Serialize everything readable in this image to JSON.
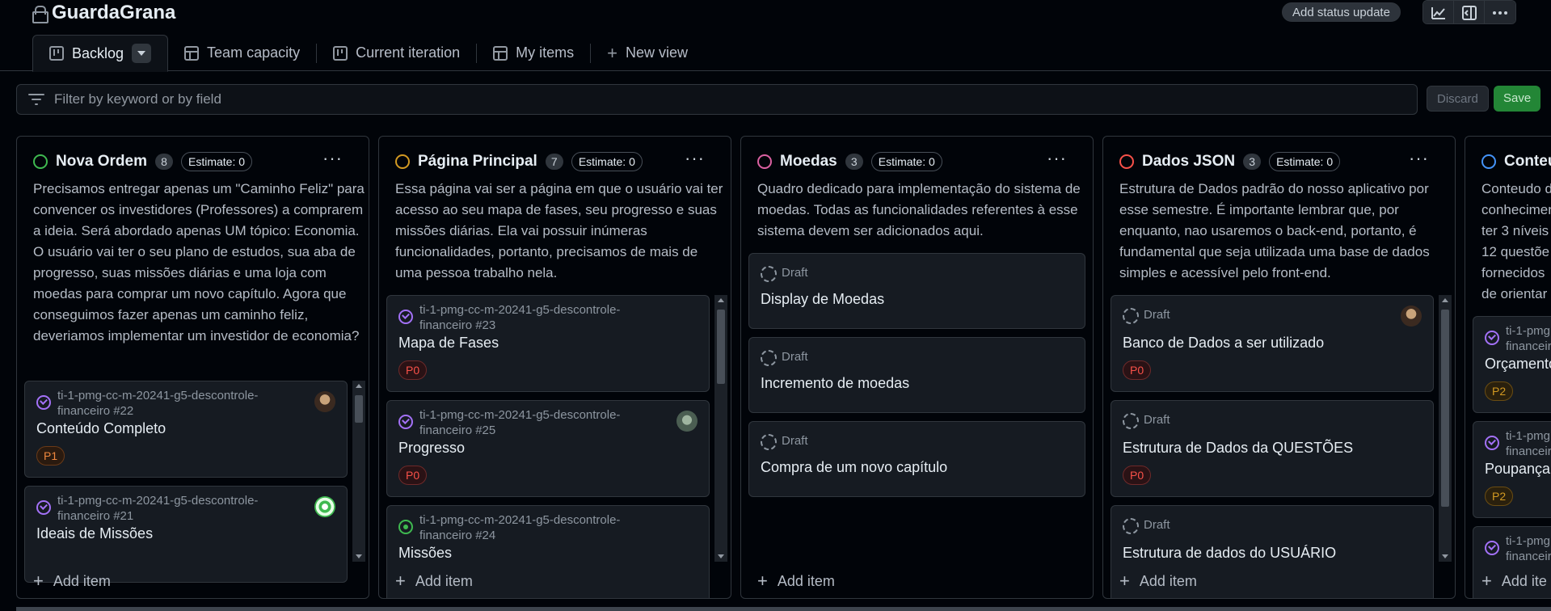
{
  "header": {
    "title": "GuardaGrana",
    "status_button": "Add status update",
    "action_icons": [
      "insights-icon",
      "sidebar-icon",
      "more-icon"
    ]
  },
  "tabs": [
    {
      "label": "Backlog",
      "icon": "board-icon",
      "active": true
    },
    {
      "label": "Team capacity",
      "icon": "table-icon"
    },
    {
      "label": "Current iteration",
      "icon": "board-icon"
    },
    {
      "label": "My items",
      "icon": "table-icon"
    },
    {
      "label": "New view",
      "icon": "plus-icon"
    }
  ],
  "filter": {
    "placeholder": "Filter by keyword or by field",
    "discard_label": "Discard",
    "save_label": "Save"
  },
  "columns": [
    {
      "title": "Nova Ordem",
      "count": "8",
      "estimate": "Estimate: 0",
      "color": "#3fb950",
      "description": "Precisamos entregar apenas um \"Caminho Feliz\" para convencer os investidores (Professores) a comprarem a ideia. Será abordado apenas UM tópico: Economia. O usuário vai ter o seu plano de estudos, sua aba de progresso, suas missões diárias e uma loja com moedas para comprar um novo capítulo. Agora que conseguimos fazer apenas um caminho feliz, deveriamos implementar um investidor de economia?",
      "cards": [
        {
          "ref": "ti-1-pmg-cc-m-20241-g5-descontrole-financeiro #22",
          "title": "Conteúdo Completo",
          "priority": "P1"
        },
        {
          "ref": "ti-1-pmg-cc-m-20241-g5-descontrole-financeiro #21",
          "title": "Ideais de Missões",
          "priority": ""
        }
      ],
      "add_item": "Add item"
    },
    {
      "title": "Página Principal",
      "count": "7",
      "estimate": "Estimate: 0",
      "color": "#d29922",
      "description": "Essa página vai ser a página em que o usuário vai ter acesso ao seu mapa de fases, seu progresso e suas missões diárias. Ela vai possuir inúmeras funcionalidades, portanto, precisamos de mais de uma pessoa trabalho nela.",
      "cards": [
        {
          "ref": "ti-1-pmg-cc-m-20241-g5-descontrole-financeiro #23",
          "title": "Mapa de Fases",
          "priority": "P0"
        },
        {
          "ref": "ti-1-pmg-cc-m-20241-g5-descontrole-financeiro #25",
          "title": "Progresso",
          "priority": "P0"
        },
        {
          "ref": "ti-1-pmg-cc-m-20241-g5-descontrole-financeiro #24",
          "title": "Missões",
          "priority": ""
        }
      ],
      "add_item": "Add item"
    },
    {
      "title": "Moedas",
      "count": "3",
      "estimate": "Estimate: 0",
      "color": "#db61a2",
      "description": "Quadro dedicado para implementação do sistema de moedas. Todas as funcionalidades referentes à esse sistema devem ser adicionados aqui.",
      "cards": [
        {
          "draft": "Draft",
          "title": "Display de Moedas"
        },
        {
          "draft": "Draft",
          "title": "Incremento de moedas"
        },
        {
          "draft": "Draft",
          "title": "Compra de um novo capítulo"
        }
      ],
      "add_item": "Add item"
    },
    {
      "title": "Dados JSON",
      "count": "3",
      "estimate": "Estimate: 0",
      "color": "#f85149",
      "description": "Estrutura de Dados padrão do nosso aplicativo por esse semestre. É importante lembrar que, por enquanto, nao usaremos o back-end, portanto, é fundamental que seja utilizada uma base de dados simples e acessível pelo front-end.",
      "cards": [
        {
          "draft": "Draft",
          "title": "Banco de Dados a ser utilizado",
          "priority": "P0"
        },
        {
          "draft": "Draft",
          "title": "Estrutura de Dados da QUESTÕES",
          "priority": "P0"
        },
        {
          "draft": "Draft",
          "title": "Estrutura de dados do USUÁRIO",
          "priority": ""
        }
      ],
      "add_item": "Add item"
    },
    {
      "title": "Conteu",
      "color": "#4493f8",
      "description_lines": [
        "Conteudo d",
        "conhecimen",
        "ter 3 níveis",
        "12 questõe",
        "fornecidos",
        "de orientar"
      ],
      "cards": [
        {
          "ref_lines": [
            "ti-1-pmg",
            "financeir"
          ],
          "title": "Orçamento",
          "priority": "P2"
        },
        {
          "ref_lines": [
            "ti-1-pmg",
            "financeir"
          ],
          "title": "Poupança",
          "priority": "P2"
        },
        {
          "ref_lines": [
            "ti-1-pmg",
            "financeir"
          ],
          "title": "",
          "priority": ""
        }
      ],
      "add_item": "Add ite"
    }
  ]
}
